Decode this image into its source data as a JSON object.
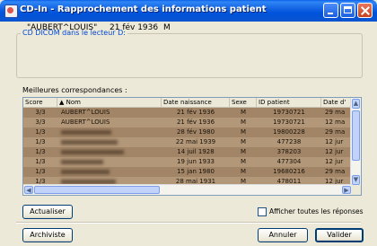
{
  "window": {
    "title": "CD-In - Rapprochement des informations patient"
  },
  "source_group": {
    "legend": "CD DICOM dans le lecteur D:",
    "patient_name": "\"AUBERT^LOUIS\"",
    "patient_dob": "21 fév 1936",
    "patient_sex": "M"
  },
  "matches": {
    "label": "Meilleures correspondances :",
    "sort_indicator": "▲",
    "columns": [
      "Score",
      "Nom",
      "Date naissance",
      "Sexe",
      "ID patient",
      "Date d'"
    ],
    "rows": [
      {
        "score": "3/3",
        "name": "AUBERT^LOUIS",
        "dob": "21 fév 1936",
        "sex": "M",
        "id": "19730721",
        "date": "29 ma"
      },
      {
        "score": "3/3",
        "name": "AUBERT^LOUIS",
        "dob": "21 fév 1936",
        "sex": "M",
        "id": "19730721",
        "date": "12 ma"
      },
      {
        "score": "1/3",
        "name": "",
        "dob": "28 fév 1980",
        "sex": "M",
        "id": "19800228",
        "date": "29 ma"
      },
      {
        "score": "1/3",
        "name": "",
        "dob": "22 mai 1939",
        "sex": "M",
        "id": "477238",
        "date": "12 jur"
      },
      {
        "score": "1/3",
        "name": "",
        "dob": "14 juil 1928",
        "sex": "M",
        "id": "378203",
        "date": "12 jur"
      },
      {
        "score": "1/3",
        "name": "",
        "dob": "19 jun 1933",
        "sex": "M",
        "id": "477304",
        "date": "12 jur"
      },
      {
        "score": "1/3",
        "name": "",
        "dob": "15 jan 1980",
        "sex": "M",
        "id": "19680216",
        "date": "29 ma"
      },
      {
        "score": "1/3",
        "name": "",
        "dob": "28 mai 1931",
        "sex": "M",
        "id": "478011",
        "date": "12 jur"
      }
    ]
  },
  "buttons": {
    "refresh": "Actualiser",
    "show_all": "Afficher toutes les réponses",
    "archivist": "Archiviste",
    "cancel": "Annuler",
    "validate": "Valider"
  }
}
